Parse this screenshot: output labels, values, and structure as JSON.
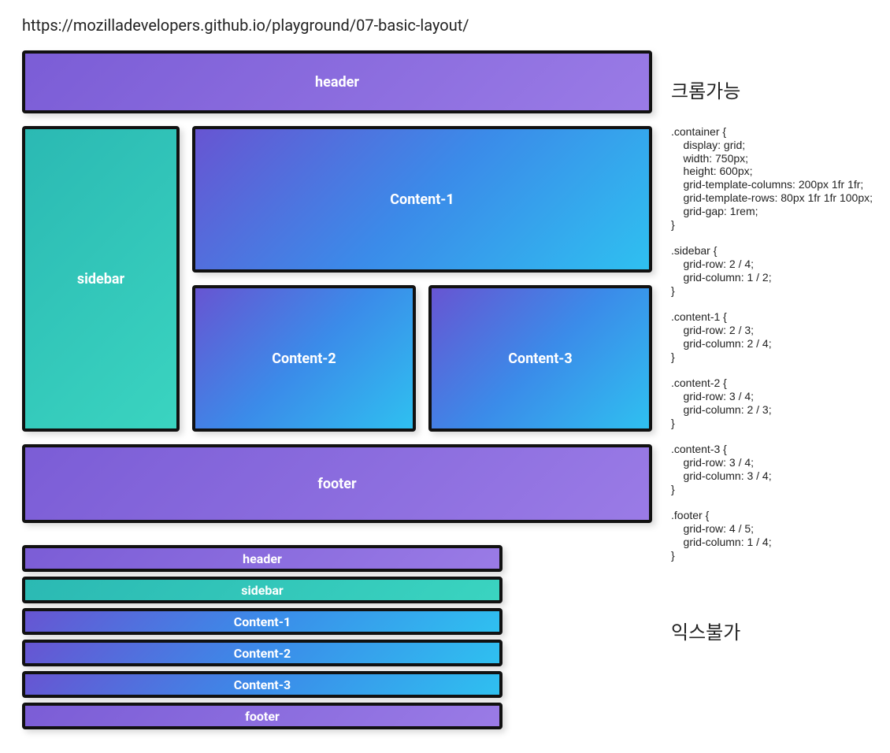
{
  "url": "https://mozilladevelopers.github.io/playground/07-basic-layout/",
  "grid": {
    "header": "header",
    "sidebar": "sidebar",
    "content1": "Content-1",
    "content2": "Content-2",
    "content3": "Content-3",
    "footer": "footer"
  },
  "stack": {
    "header": "header",
    "sidebar": "sidebar",
    "content1": "Content-1",
    "content2": "Content-2",
    "content3": "Content-3",
    "footer": "footer"
  },
  "right": {
    "title1": "크롬가능",
    "title2": "익스불가",
    "code": ".container {\n    display: grid;\n    width: 750px;\n    height: 600px;\n    grid-template-columns: 200px 1fr 1fr;\n    grid-template-rows: 80px 1fr 1fr 100px;\n    grid-gap: 1rem;\n}\n\n.sidebar {\n    grid-row: 2 / 4;\n    grid-column: 1 / 2;\n}\n\n.content-1 {\n    grid-row: 2 / 3;\n    grid-column: 2 / 4;\n}\n\n.content-2 {\n    grid-row: 3 / 4;\n    grid-column: 2 / 3;\n}\n\n.content-3 {\n    grid-row: 3 / 4;\n    grid-column: 3 / 4;\n}\n\n.footer {\n    grid-row: 4 / 5;\n    grid-column: 1 / 4;\n}"
  }
}
